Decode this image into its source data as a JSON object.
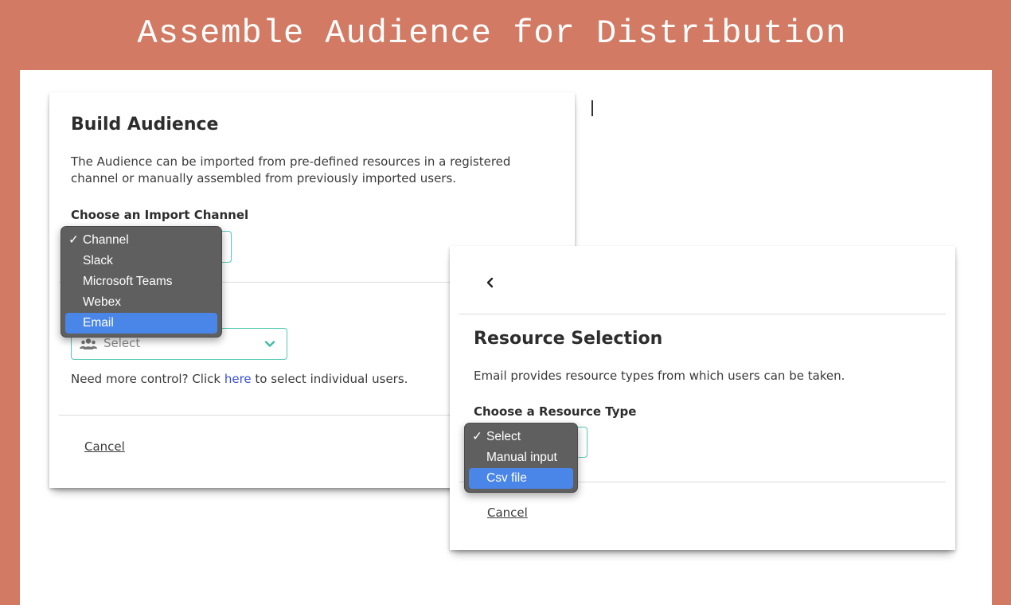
{
  "page": {
    "title": "Assemble Audience for Distribution"
  },
  "build_card": {
    "heading": "Build Audience",
    "description": "The Audience can be imported from pre-defined resources in a registered channel or manually assembled from previously imported users.",
    "channel_label": "Choose an Import Channel",
    "channel_menu": {
      "items": [
        {
          "label": "Channel",
          "checked": true,
          "highlighted": false
        },
        {
          "label": "Slack",
          "checked": false,
          "highlighted": false
        },
        {
          "label": "Microsoft Teams",
          "checked": false,
          "highlighted": false
        },
        {
          "label": "Webex",
          "checked": false,
          "highlighted": false
        },
        {
          "label": "Email",
          "checked": false,
          "highlighted": true
        }
      ]
    },
    "resource_select": {
      "placeholder": "Select",
      "icon": "users-icon"
    },
    "help_text": {
      "before": "Need more control? Click ",
      "link": "here",
      "after": " to select individual users."
    },
    "cancel_label": "Cancel"
  },
  "resource_card": {
    "back_icon": "chevron-left-icon",
    "heading": "Resource Selection",
    "description": "Email provides resource types from which users can be taken.",
    "type_label": "Choose a Resource Type",
    "type_menu": {
      "items": [
        {
          "label": "Select",
          "checked": true,
          "highlighted": false
        },
        {
          "label": "Manual input",
          "checked": false,
          "highlighted": false
        },
        {
          "label": "Csv file",
          "checked": false,
          "highlighted": true
        }
      ]
    },
    "cancel_label": "Cancel"
  },
  "colors": {
    "background": "#d27a63",
    "accent_teal": "#52c9b3",
    "menu_bg": "#5f5f5f",
    "menu_highlight": "#4a86e8",
    "link": "#3a4fd6"
  }
}
